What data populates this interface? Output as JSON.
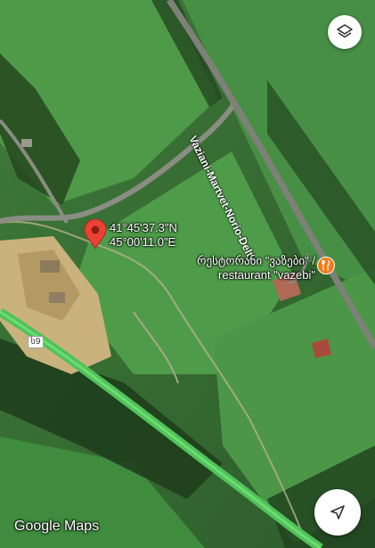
{
  "map": {
    "type": "satellite",
    "colors": {
      "pin": "#ea4335",
      "poi": "#f07c1b",
      "highway": "#4fc35a"
    }
  },
  "pin": {
    "lat": "41°45'37.3\"N",
    "lon": "45°00'11.0\"E",
    "icon": "location-pin-icon"
  },
  "poi": {
    "name_ka": "რესტორანი \"ვაზები\" /",
    "name_en": "restaurant \"vazebi\"",
    "icon": "restaurant-icon"
  },
  "roads": {
    "main_label": "Vaziani-Martvet-Norio-Delty",
    "shield": "ს9"
  },
  "controls": {
    "layers_icon": "layers-icon",
    "location_icon": "navigation-arrow-icon"
  },
  "attribution": "Google Maps"
}
